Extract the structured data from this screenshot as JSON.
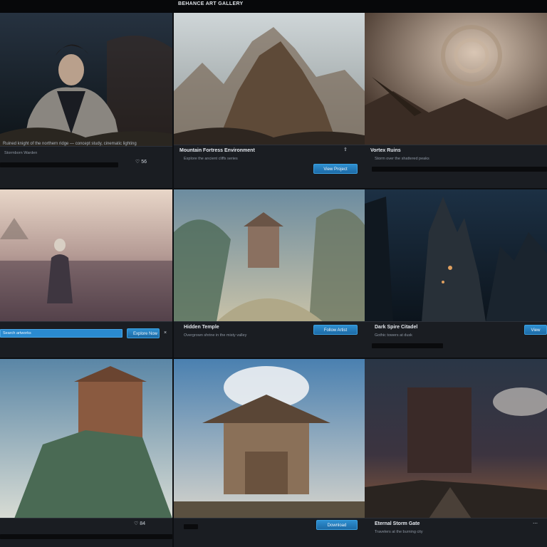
{
  "window": {
    "title": "BEHANCE ART GALLERY"
  },
  "cards": [
    {
      "caption": "Ruined knight of the northern ridge — concept study, cinematic lighting",
      "meta": "Stormborn Warden",
      "stats": "♡ 56"
    },
    {
      "heading": "Mountain Fortress Environment",
      "meta": "Explore the ancient cliffs series",
      "button": "View Project"
    },
    {
      "heading": "Vortex Ruins",
      "meta": "Storm over the shattered peaks"
    },
    {
      "input": "Search artworks",
      "button": "Explore Now"
    },
    {
      "heading": "Hidden Temple",
      "meta": "Overgrown shrine in the misty valley",
      "button": "Follow Artist"
    },
    {
      "heading": "Dark Spire Citadel",
      "meta": "Gothic towers at dusk",
      "button": "View"
    },
    {
      "stats": "♡ 84"
    },
    {
      "button": "Download"
    },
    {
      "heading": "Eternal Storm Gate",
      "meta": "Travelers at the burning city"
    }
  ]
}
